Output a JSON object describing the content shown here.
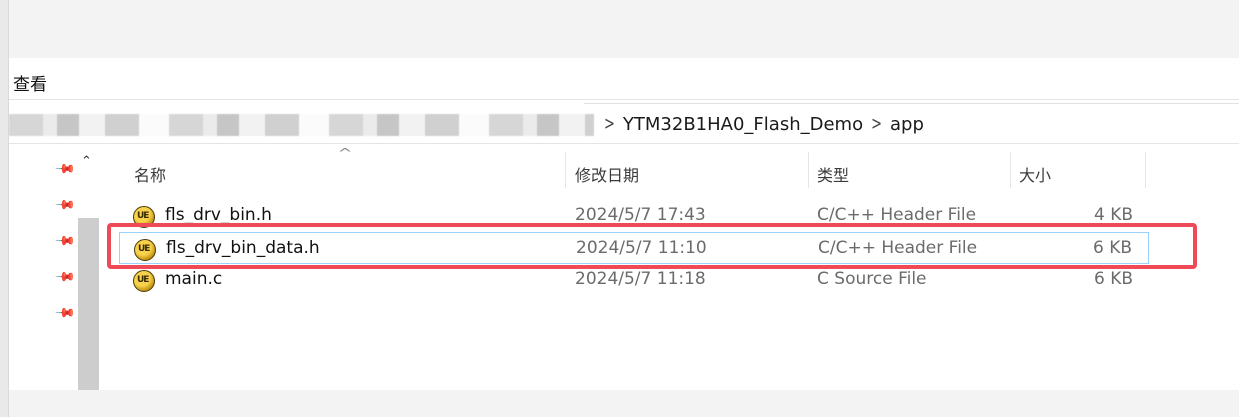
{
  "ribbon": {
    "view_label": "查看"
  },
  "address": {
    "crumbs": [
      "YTM32B1HA0_Flash_Demo",
      "app"
    ]
  },
  "columns": {
    "name": "名称",
    "modified": "修改日期",
    "type": "类型",
    "size": "大小"
  },
  "files": [
    {
      "name": "fls_drv_bin.h",
      "modified": "2024/5/7 17:43",
      "type": "C/C++ Header File",
      "size": "4 KB",
      "icon": "ultraedit-file-icon"
    },
    {
      "name": "fls_drv_bin_data.h",
      "modified": "2024/5/7 11:10",
      "type": "C/C++ Header File",
      "size": "6 KB",
      "icon": "ultraedit-file-icon",
      "selected": true
    },
    {
      "name": "main.c",
      "modified": "2024/5/7 11:18",
      "type": "C Source File",
      "size": "6 KB",
      "icon": "ultraedit-file-icon"
    }
  ],
  "colors": {
    "highlight": "#ef4a58",
    "selection_border": "#99d1ff"
  },
  "nav": {
    "pinned_count": 5
  }
}
